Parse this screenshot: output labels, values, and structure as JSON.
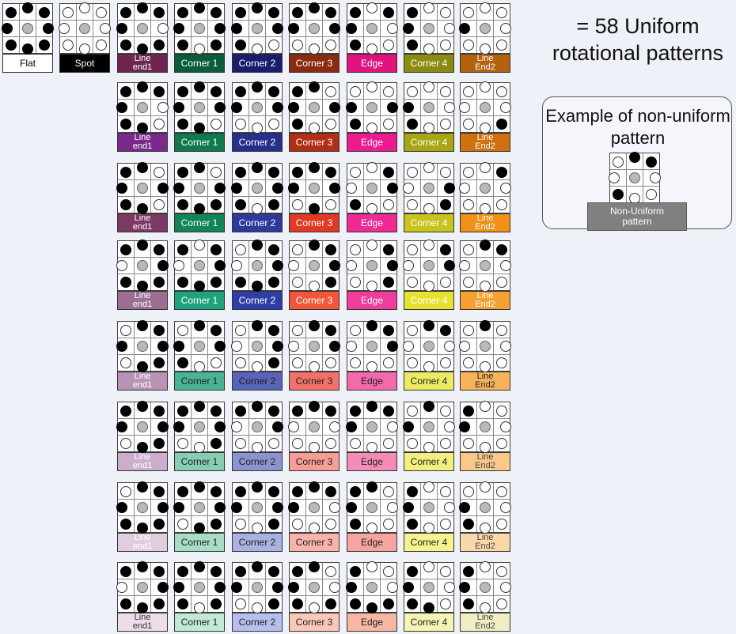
{
  "title": "= 58 Uniform rotational patterns",
  "example": {
    "title": "Example of non-uniform pattern",
    "label": "Non-Uniform\npattern",
    "pattern": [
      1,
      1,
      0,
      0,
      0,
      1,
      0,
      0
    ]
  },
  "flat": {
    "label": "Flat",
    "color": "#ffffff",
    "text_color": "#000000",
    "pattern": [
      1,
      1,
      1,
      1,
      1,
      1,
      1,
      1
    ]
  },
  "spot": {
    "label": "Spot",
    "color": "#000000",
    "text_color": "#ffffff",
    "pattern": [
      0,
      0,
      0,
      0,
      0,
      0,
      0,
      0
    ]
  },
  "column_labels": [
    "Line\nend1",
    "Corner 1",
    "Corner 2",
    "Corner 3",
    "Edge",
    "Corner 4",
    "Line\nEnd2"
  ],
  "row_labels": [
    [
      "Line\nend1",
      "Corner 1",
      "Corner 2",
      "Corner 3",
      "Edge",
      "Corner 4",
      "Line\nEnd2"
    ],
    [
      "Line\nend1",
      "Corner 1",
      "Corner 2",
      "Corner 3",
      "Edge",
      "Corner 4",
      "Line\nEnd2"
    ],
    [
      "Line\nend1",
      "Corner 1",
      "Corner 2",
      "Corner 3",
      "Edge",
      "Corner 4",
      "Line\nEnd2"
    ],
    [
      "Line\nend1",
      "Corner 1",
      "Corner 2",
      "Corner 3",
      "Edge",
      "Corner 4",
      "Line\nEnd2"
    ],
    [
      "Line\nend1",
      "Corner 1",
      "Corner 2",
      "Corner 3",
      "Edge",
      "Corner 4",
      "Line\nEnd2"
    ],
    [
      "Line\nend1",
      "Corner 1",
      "Corner 2",
      "Corner 3",
      "Edge",
      "Corner 4",
      "Line\nEnd2"
    ],
    [
      "Line\nend1",
      "Corner 1",
      "Corner 2",
      "Corner 3",
      "Edge",
      "Corner 4",
      "Line\nEnd2"
    ],
    [
      "Line\nend1",
      "Corner 1",
      "Corner 2",
      "Corner 3",
      "Edge",
      "Corner 4",
      "Line\nEnd2"
    ]
  ],
  "column_colors": [
    [
      "#6e2550",
      "#0b5c3b",
      "#1a1c6e",
      "#8a2a0f",
      "#e0137f",
      "#8b8b12",
      "#b5620f"
    ],
    [
      "#7a2a8a",
      "#107a4e",
      "#272f8c",
      "#b22f15",
      "#ec1b8f",
      "#a8a615",
      "#d0700f"
    ],
    [
      "#7b3a63",
      "#11845a",
      "#2d3a9c",
      "#e03a25",
      "#ee2a95",
      "#c8c41e",
      "#f29018"
    ],
    [
      "#9a6f92",
      "#1fa37a",
      "#2f3ea6",
      "#f2553a",
      "#f03c9b",
      "#e6e330",
      "#f7a032"
    ],
    [
      "#b794b5",
      "#4ab394",
      "#5864b8",
      "#f4716a",
      "#f26aab",
      "#ecea62",
      "#f8b35a"
    ],
    [
      "#ccaecc",
      "#86cdb2",
      "#8c94cf",
      "#f69e96",
      "#f38cb7",
      "#f1ef7d",
      "#fac98a"
    ],
    [
      "#e2cce0",
      "#a8dcc6",
      "#aab2e3",
      "#f8b3aa",
      "#f5a4a0",
      "#f6f48e",
      "#fbd8a9"
    ],
    [
      "#ecdde9",
      "#c2e9d6",
      "#b7bff0",
      "#fac8b8",
      "#f6b7a3",
      "#f5f3b6",
      "#f1eec3"
    ]
  ],
  "dark_text_threshold_rows": 4,
  "patterns": [
    [
      [
        1,
        1,
        0,
        1,
        1,
        1,
        1,
        1
      ],
      [
        1,
        1,
        1,
        1,
        0,
        1,
        1,
        1
      ],
      [
        1,
        1,
        1,
        0,
        0,
        1,
        1,
        1
      ],
      [
        1,
        1,
        1,
        0,
        0,
        0,
        1,
        1
      ],
      [
        0,
        1,
        0,
        0,
        0,
        1,
        1,
        1
      ],
      [
        0,
        0,
        0,
        0,
        0,
        1,
        1,
        1
      ],
      [
        0,
        0,
        0,
        0,
        0,
        0,
        1,
        0
      ]
    ],
    [
      [
        1,
        1,
        0,
        0,
        1,
        1,
        1,
        1
      ],
      [
        1,
        1,
        1,
        0,
        1,
        1,
        1,
        1
      ],
      [
        1,
        1,
        1,
        0,
        0,
        0,
        1,
        1
      ],
      [
        1,
        0,
        1,
        0,
        0,
        1,
        1,
        1
      ],
      [
        0,
        0,
        1,
        0,
        0,
        1,
        1,
        0
      ],
      [
        0,
        0,
        0,
        0,
        0,
        1,
        1,
        0
      ],
      [
        0,
        0,
        0,
        1,
        0,
        0,
        0,
        0
      ]
    ],
    [
      [
        1,
        0,
        1,
        0,
        1,
        1,
        1,
        1
      ],
      [
        1,
        0,
        1,
        1,
        1,
        1,
        1,
        1
      ],
      [
        1,
        1,
        1,
        1,
        0,
        1,
        1,
        1
      ],
      [
        1,
        1,
        1,
        0,
        1,
        0,
        1,
        1
      ],
      [
        0,
        1,
        1,
        0,
        0,
        1,
        0,
        0
      ],
      [
        0,
        0,
        1,
        1,
        0,
        0,
        0,
        0
      ],
      [
        0,
        1,
        0,
        0,
        0,
        0,
        0,
        0
      ]
    ],
    [
      [
        1,
        1,
        1,
        1,
        1,
        1,
        0,
        1
      ],
      [
        0,
        1,
        1,
        1,
        1,
        1,
        0,
        1
      ],
      [
        1,
        1,
        1,
        1,
        1,
        1,
        0,
        0
      ],
      [
        1,
        1,
        1,
        1,
        0,
        0,
        0,
        0
      ],
      [
        0,
        1,
        1,
        1,
        0,
        0,
        0,
        0
      ],
      [
        0,
        1,
        1,
        0,
        0,
        0,
        0,
        0
      ],
      [
        1,
        1,
        0,
        0,
        0,
        0,
        0,
        0
      ]
    ],
    [
      [
        1,
        1,
        1,
        1,
        1,
        0,
        1,
        0
      ],
      [
        1,
        1,
        1,
        0,
        0,
        1,
        1,
        0
      ],
      [
        1,
        1,
        1,
        1,
        0,
        0,
        0,
        0
      ],
      [
        1,
        1,
        1,
        0,
        0,
        0,
        0,
        0
      ],
      [
        1,
        1,
        1,
        0,
        0,
        0,
        0,
        0
      ],
      [
        1,
        1,
        0,
        0,
        0,
        0,
        0,
        0
      ],
      [
        1,
        0,
        0,
        0,
        0,
        0,
        0,
        0
      ]
    ],
    [
      [
        1,
        1,
        1,
        1,
        1,
        0,
        1,
        1
      ],
      [
        1,
        1,
        1,
        1,
        0,
        0,
        1,
        1
      ],
      [
        1,
        1,
        1,
        0,
        0,
        0,
        0,
        1
      ],
      [
        1,
        1,
        0,
        0,
        0,
        0,
        0,
        1
      ],
      [
        1,
        1,
        0,
        0,
        0,
        0,
        1,
        1
      ],
      [
        1,
        0,
        0,
        0,
        0,
        0,
        1,
        0
      ],
      [
        0,
        0,
        0,
        0,
        0,
        0,
        1,
        1
      ]
    ],
    [
      [
        1,
        1,
        1,
        1,
        1,
        1,
        1,
        0
      ],
      [
        1,
        1,
        1,
        1,
        1,
        0,
        1,
        1
      ],
      [
        1,
        1,
        1,
        1,
        0,
        0,
        1,
        1
      ],
      [
        1,
        1,
        0,
        0,
        0,
        0,
        1,
        1
      ],
      [
        1,
        0,
        0,
        0,
        0,
        1,
        1,
        1
      ],
      [
        0,
        0,
        0,
        0,
        0,
        1,
        1,
        1
      ],
      [
        0,
        0,
        0,
        0,
        0,
        1,
        1,
        0
      ]
    ],
    [
      [
        1,
        1,
        1,
        1,
        1,
        1,
        0,
        1
      ],
      [
        1,
        1,
        1,
        1,
        0,
        1,
        1,
        1
      ],
      [
        1,
        1,
        1,
        1,
        0,
        0,
        1,
        1
      ],
      [
        1,
        0,
        0,
        1,
        0,
        1,
        1,
        1
      ],
      [
        0,
        0,
        0,
        1,
        1,
        1,
        1,
        1
      ],
      [
        0,
        0,
        0,
        0,
        1,
        1,
        1,
        1
      ],
      [
        0,
        0,
        0,
        0,
        0,
        1,
        1,
        1
      ]
    ]
  ]
}
